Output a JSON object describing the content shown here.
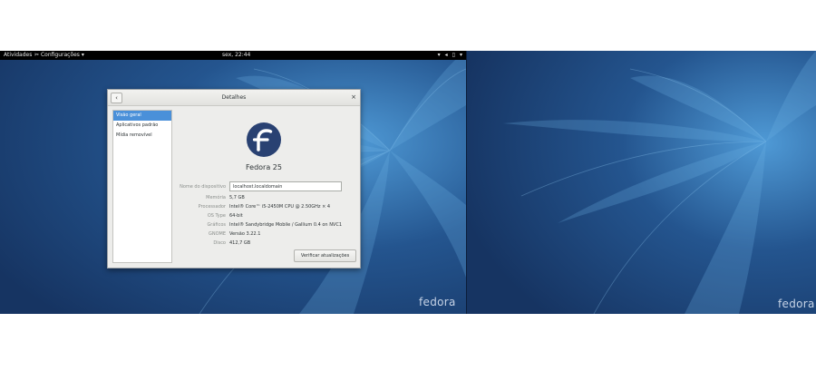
{
  "topbar": {
    "activities": "Atividades",
    "settings_menu": "Configurações",
    "clock": "sex, 22:44"
  },
  "wallpaper": {
    "brand_text": "fedora"
  },
  "dialog": {
    "title": "Detalhes",
    "back_icon": "‹",
    "close_icon": "×",
    "sidebar": [
      {
        "label": "Visão geral",
        "selected": true
      },
      {
        "label": "Aplicativos padrão",
        "selected": false
      },
      {
        "label": "Mídia removível",
        "selected": false
      }
    ],
    "os_name": "Fedora 25",
    "device_name_label": "Nome do dispositivo",
    "device_name_value": "localhost.localdomain",
    "memory_label": "Memória",
    "memory_value": "5,7 GB",
    "processor_label": "Processador",
    "processor_value": "Intel® Core™ i5-2450M CPU @ 2.50GHz × 4",
    "ostype_label": "OS Type",
    "ostype_value": "64-bit",
    "graphics_label": "Gráficos",
    "graphics_value": "Intel® Sandybridge Mobile / Gallium 0.4 on NVC1",
    "gnome_label": "GNOME",
    "gnome_value": "Versão 3.22.1",
    "disk_label": "Disco",
    "disk_value": "412,7 GB",
    "update_button": "Verificar atualizações"
  },
  "colors": {
    "wallpaper_dark": "#1a3f73",
    "wallpaper_light": "#3a7fc0",
    "selection": "#4a90d9",
    "fedora_blue": "#294172"
  }
}
